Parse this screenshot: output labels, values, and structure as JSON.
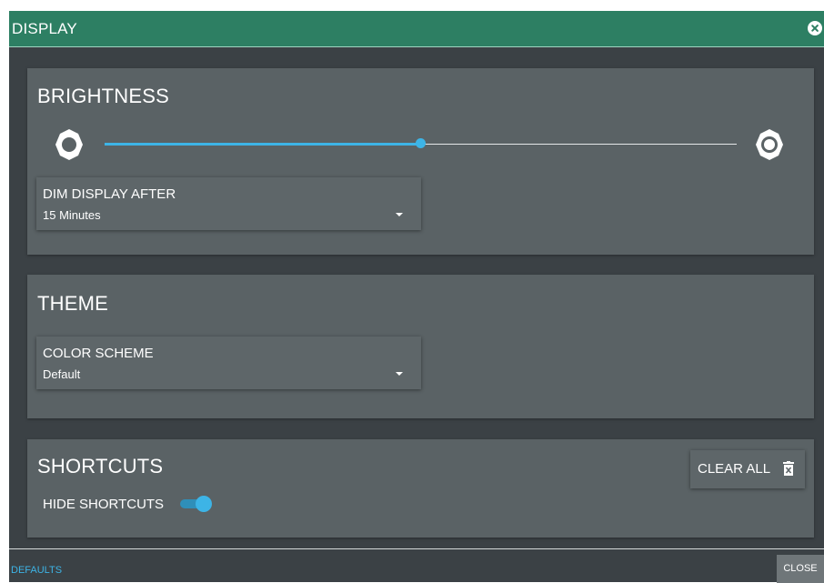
{
  "dialog": {
    "title": "DISPLAY",
    "close_icon": "close-circle-icon"
  },
  "brightness": {
    "title": "BRIGHTNESS",
    "level": 0.5,
    "low_icon": "brightness-low-icon",
    "high_icon": "brightness-high-icon",
    "dim": {
      "label": "DIM DISPLAY AFTER",
      "value": "15 Minutes"
    }
  },
  "theme": {
    "title": "THEME",
    "color_scheme": {
      "label": "COLOR SCHEME",
      "value": "Default"
    }
  },
  "shortcuts": {
    "title": "SHORTCUTS",
    "clear_all_label": "CLEAR ALL",
    "clear_all_icon": "trash-icon",
    "hide_label": "HIDE SHORTCUTS",
    "hide_enabled": true
  },
  "footer": {
    "defaults_label": "DEFAULTS",
    "close_label": "CLOSE"
  },
  "colors": {
    "header": "#2d7f63",
    "background": "#3b4145",
    "card": "#5a6265",
    "accent": "#3db4e6"
  }
}
